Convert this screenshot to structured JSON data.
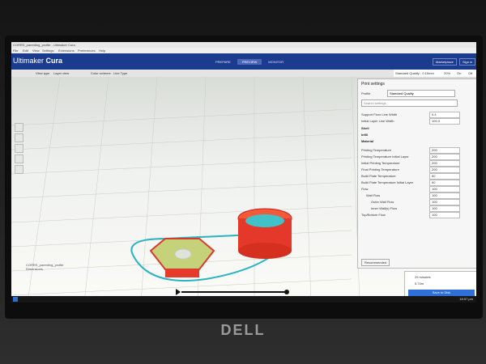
{
  "window_title": "CORRS_parenting_profile - Ultimaker Cura",
  "menu": [
    "File",
    "Edit",
    "View",
    "Settings",
    "Extensions",
    "Preferences",
    "Help"
  ],
  "app": {
    "brand_light": "Ultimaker",
    "brand_bold": "Cura"
  },
  "stages": [
    {
      "label": "PREPARE",
      "active": false
    },
    {
      "label": "PREVIEW",
      "active": true
    },
    {
      "label": "MONITOR",
      "active": false
    }
  ],
  "header_buttons": {
    "marketplace": "Marketplace",
    "signin": "Sign in"
  },
  "subbar": {
    "color_scheme_label": "View type",
    "color_scheme_value": "Layer view",
    "second_label": "Color scheme",
    "second_value": "Line Type"
  },
  "profile_bar": {
    "label": "Standard Quality - 0.15mm",
    "infill": "20%",
    "support": "On",
    "adhesion": "Off"
  },
  "print_settings": {
    "title": "Print settings",
    "profile_label": "Profile",
    "profile_value": "Standard Quality",
    "search_placeholder": "Search settings",
    "rows": [
      {
        "label": "Support Floor Line Width",
        "value": "0.4"
      },
      {
        "label": "Initial Layer Line Width",
        "value": "100.0"
      }
    ],
    "categories": [
      "Shell",
      "Infill",
      "Material"
    ],
    "material_rows": [
      {
        "label": "Printing Temperature",
        "value": "200"
      },
      {
        "label": "Printing Temperature Initial Layer",
        "value": "200"
      },
      {
        "label": "Initial Printing Temperature",
        "value": "200"
      },
      {
        "label": "Final Printing Temperature",
        "value": "200"
      },
      {
        "label": "Build Plate Temperature",
        "value": "60"
      },
      {
        "label": "Build Plate Temperature Initial Layer",
        "value": "60"
      },
      {
        "label": "Flow",
        "value": "100"
      },
      {
        "label": "Wall Flow",
        "value": "100"
      },
      {
        "label": "Outer Wall Flow",
        "value": "100"
      },
      {
        "label": "Inner Wall(s) Flow",
        "value": "100"
      },
      {
        "label": "Top/Bottom Flow",
        "value": "100"
      }
    ],
    "recommended_button": "Recommended"
  },
  "estimate": {
    "time": "29 minutes",
    "material": "5.74m",
    "button": "Save to Disk"
  },
  "bottom_left": [
    "CORRS_parenting_profile",
    "Dimensions"
  ],
  "clock": "18:57 pm"
}
